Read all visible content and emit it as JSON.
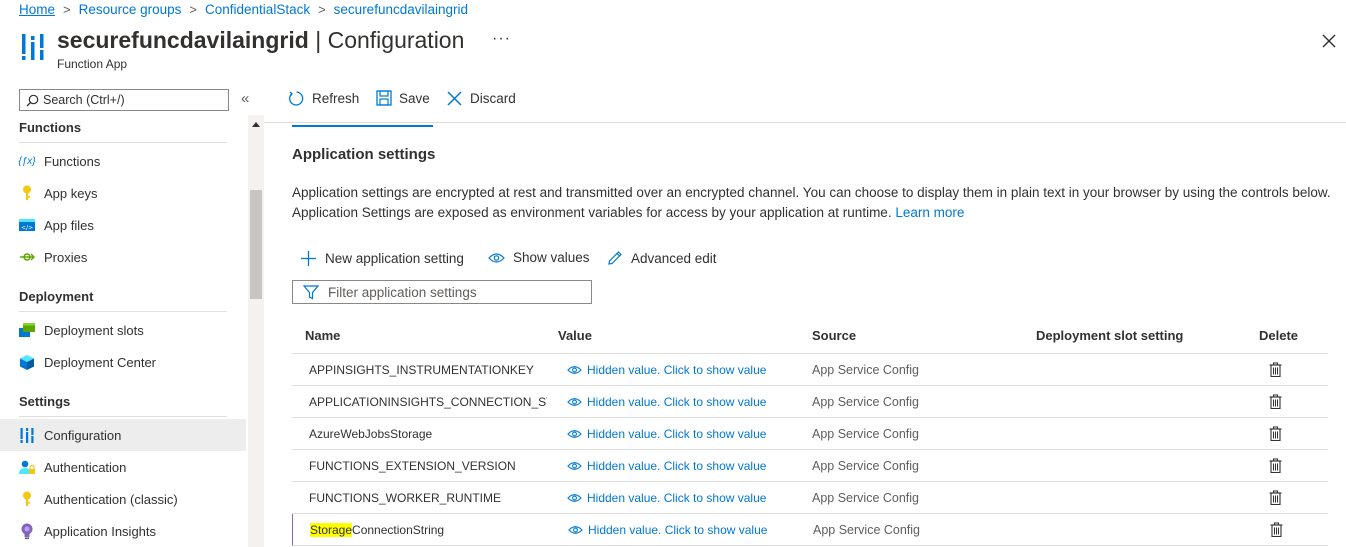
{
  "breadcrumb": [
    "Home",
    "Resource groups",
    "ConfidentialStack",
    "securefuncdavilaingrid"
  ],
  "header": {
    "title_name": "securefuncdavilaingrid",
    "title_sep": " | ",
    "title_page": "Configuration",
    "subtitle": "Function App",
    "more": "···"
  },
  "sidebar": {
    "search_placeholder": "Search (Ctrl+/)",
    "collapse": "«",
    "groups": {
      "functions": "Functions",
      "deployment": "Deployment",
      "settings": "Settings"
    },
    "items": [
      {
        "label": "Functions",
        "icon": "function-icon"
      },
      {
        "label": "App keys",
        "icon": "key-icon"
      },
      {
        "label": "App files",
        "icon": "code-file-icon"
      },
      {
        "label": "Proxies",
        "icon": "proxy-icon"
      },
      {
        "label": "Deployment slots",
        "icon": "slots-icon"
      },
      {
        "label": "Deployment Center",
        "icon": "cube-icon"
      },
      {
        "label": "Configuration",
        "icon": "config-icon",
        "active": true
      },
      {
        "label": "Authentication",
        "icon": "user-lock-icon"
      },
      {
        "label": "Authentication (classic)",
        "icon": "key-icon"
      },
      {
        "label": "Application Insights",
        "icon": "lightbulb-icon"
      }
    ]
  },
  "toolbar": {
    "refresh": "Refresh",
    "save": "Save",
    "discard": "Discard"
  },
  "main": {
    "section_title": "Application settings",
    "description": "Application settings are encrypted at rest and transmitted over an encrypted channel. You can choose to display them in plain text in your browser by using the controls below. Application Settings are exposed as environment variables for access by your application at runtime.",
    "learn_more": "Learn more",
    "commands": {
      "new_setting": "New application setting",
      "show_values": "Show values",
      "advanced_edit": "Advanced edit"
    },
    "filter_placeholder": "Filter application settings",
    "columns": [
      "Name",
      "Value",
      "Source",
      "Deployment slot setting",
      "Delete"
    ],
    "rows": [
      {
        "name": "APPINSIGHTS_INSTRUMENTATIONKEY",
        "value": "Hidden value. Click to show value",
        "source": "App Service Config"
      },
      {
        "name": "APPLICATIONINSIGHTS_CONNECTION_STRING",
        "value": "Hidden value. Click to show value",
        "source": "App Service Config"
      },
      {
        "name": "AzureWebJobsStorage",
        "value": "Hidden value. Click to show value",
        "source": "App Service Config"
      },
      {
        "name": "FUNCTIONS_EXTENSION_VERSION",
        "value": "Hidden value. Click to show value",
        "source": "App Service Config"
      },
      {
        "name": "FUNCTIONS_WORKER_RUNTIME",
        "value": "Hidden value. Click to show value",
        "source": "App Service Config"
      },
      {
        "name_highlight": "Storage",
        "name_rest": "ConnectionString",
        "value": "Hidden value. Click to show value",
        "source": "App Service Config"
      }
    ]
  },
  "colors": {
    "accent": "#0078d4",
    "highlight": "#ffff00",
    "selected_border": "#8764b8"
  }
}
